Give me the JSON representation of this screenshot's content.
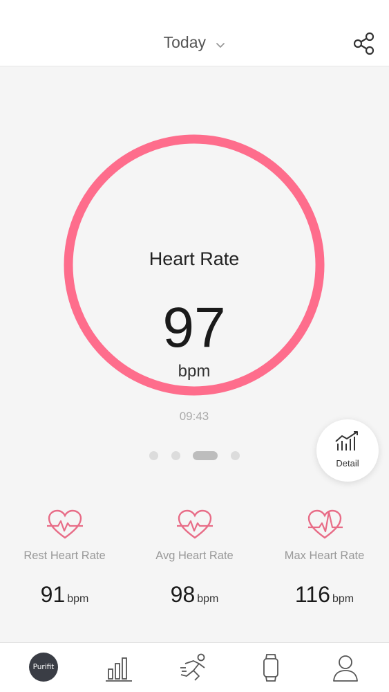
{
  "header": {
    "date_label": "Today",
    "share_icon": "share-icon",
    "chevron_icon": "chevron-down-icon"
  },
  "heart_rate": {
    "title": "Heart Rate",
    "value": "97",
    "unit": "bpm",
    "time": "09:43",
    "ring_color": "#fe6d8c"
  },
  "pager": {
    "count": 4,
    "active_index": 2
  },
  "detail": {
    "label": "Detail",
    "icon": "trend-chart-icon"
  },
  "stats": [
    {
      "label": "Rest Heart Rate",
      "value": "91",
      "unit": "bpm",
      "icon": "heart-pulse-icon"
    },
    {
      "label": "Avg Heart Rate",
      "value": "98",
      "unit": "bpm",
      "icon": "heart-pulse-icon"
    },
    {
      "label": "Max Heart Rate",
      "value": "116",
      "unit": "bpm",
      "icon": "heart-peak-icon"
    }
  ],
  "tabbar": {
    "items": [
      {
        "name": "home",
        "label": "Purifit",
        "icon": "purifit-logo"
      },
      {
        "name": "stats",
        "icon": "bar-chart-icon"
      },
      {
        "name": "sport",
        "icon": "running-icon"
      },
      {
        "name": "device",
        "icon": "watch-icon"
      },
      {
        "name": "profile",
        "icon": "user-icon"
      }
    ]
  },
  "colors": {
    "accent": "#fe6d8c",
    "icon_accent": "#e86c87",
    "tab_icon": "#555555"
  }
}
